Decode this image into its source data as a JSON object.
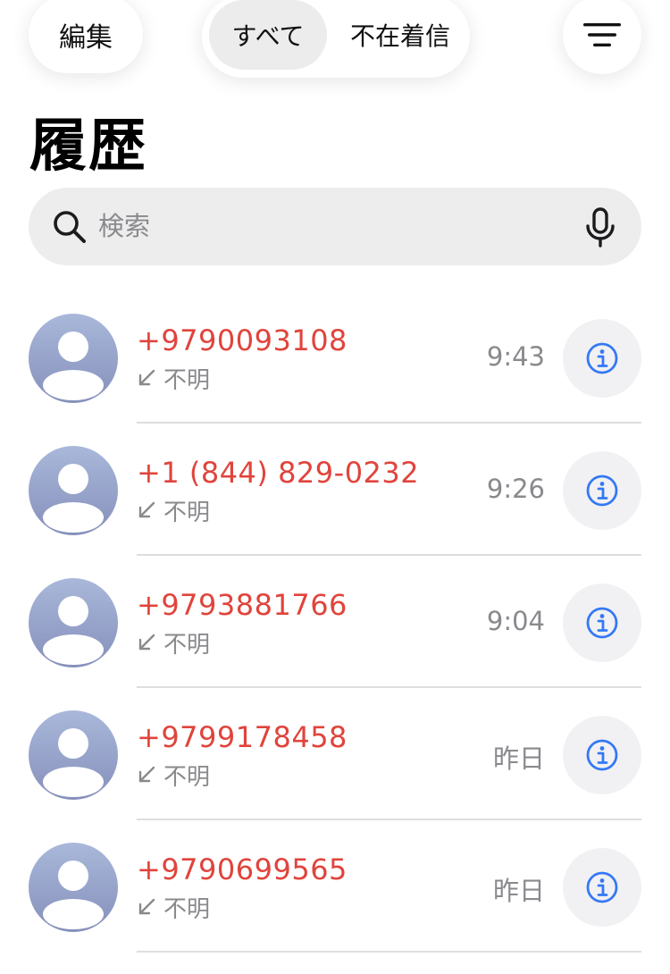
{
  "header": {
    "edit_label": "編集",
    "segments": [
      {
        "label": "すべて",
        "selected": true
      },
      {
        "label": "不在着信",
        "selected": false
      }
    ],
    "filter_icon": "filter-icon"
  },
  "page_title": "履歴",
  "search": {
    "placeholder": "検索",
    "value": "",
    "icon": "search-icon",
    "mic_icon": "microphone-icon"
  },
  "colors": {
    "missed_call": "#e0443c",
    "info_accent": "#3478f6",
    "secondary_text": "#8a8a8e",
    "avatar_top": "#a9b8da",
    "avatar_bottom": "#8690bb"
  },
  "calls": [
    {
      "number": "+9790093108",
      "label": "不明",
      "time": "9:43"
    },
    {
      "number": "+1 (844) 829-0232",
      "label": "不明",
      "time": "9:26"
    },
    {
      "number": "+9793881766",
      "label": "不明",
      "time": "9:04"
    },
    {
      "number": "+9799178458",
      "label": "不明",
      "time": "昨日"
    },
    {
      "number": "+9790699565",
      "label": "不明",
      "time": "昨日"
    }
  ]
}
